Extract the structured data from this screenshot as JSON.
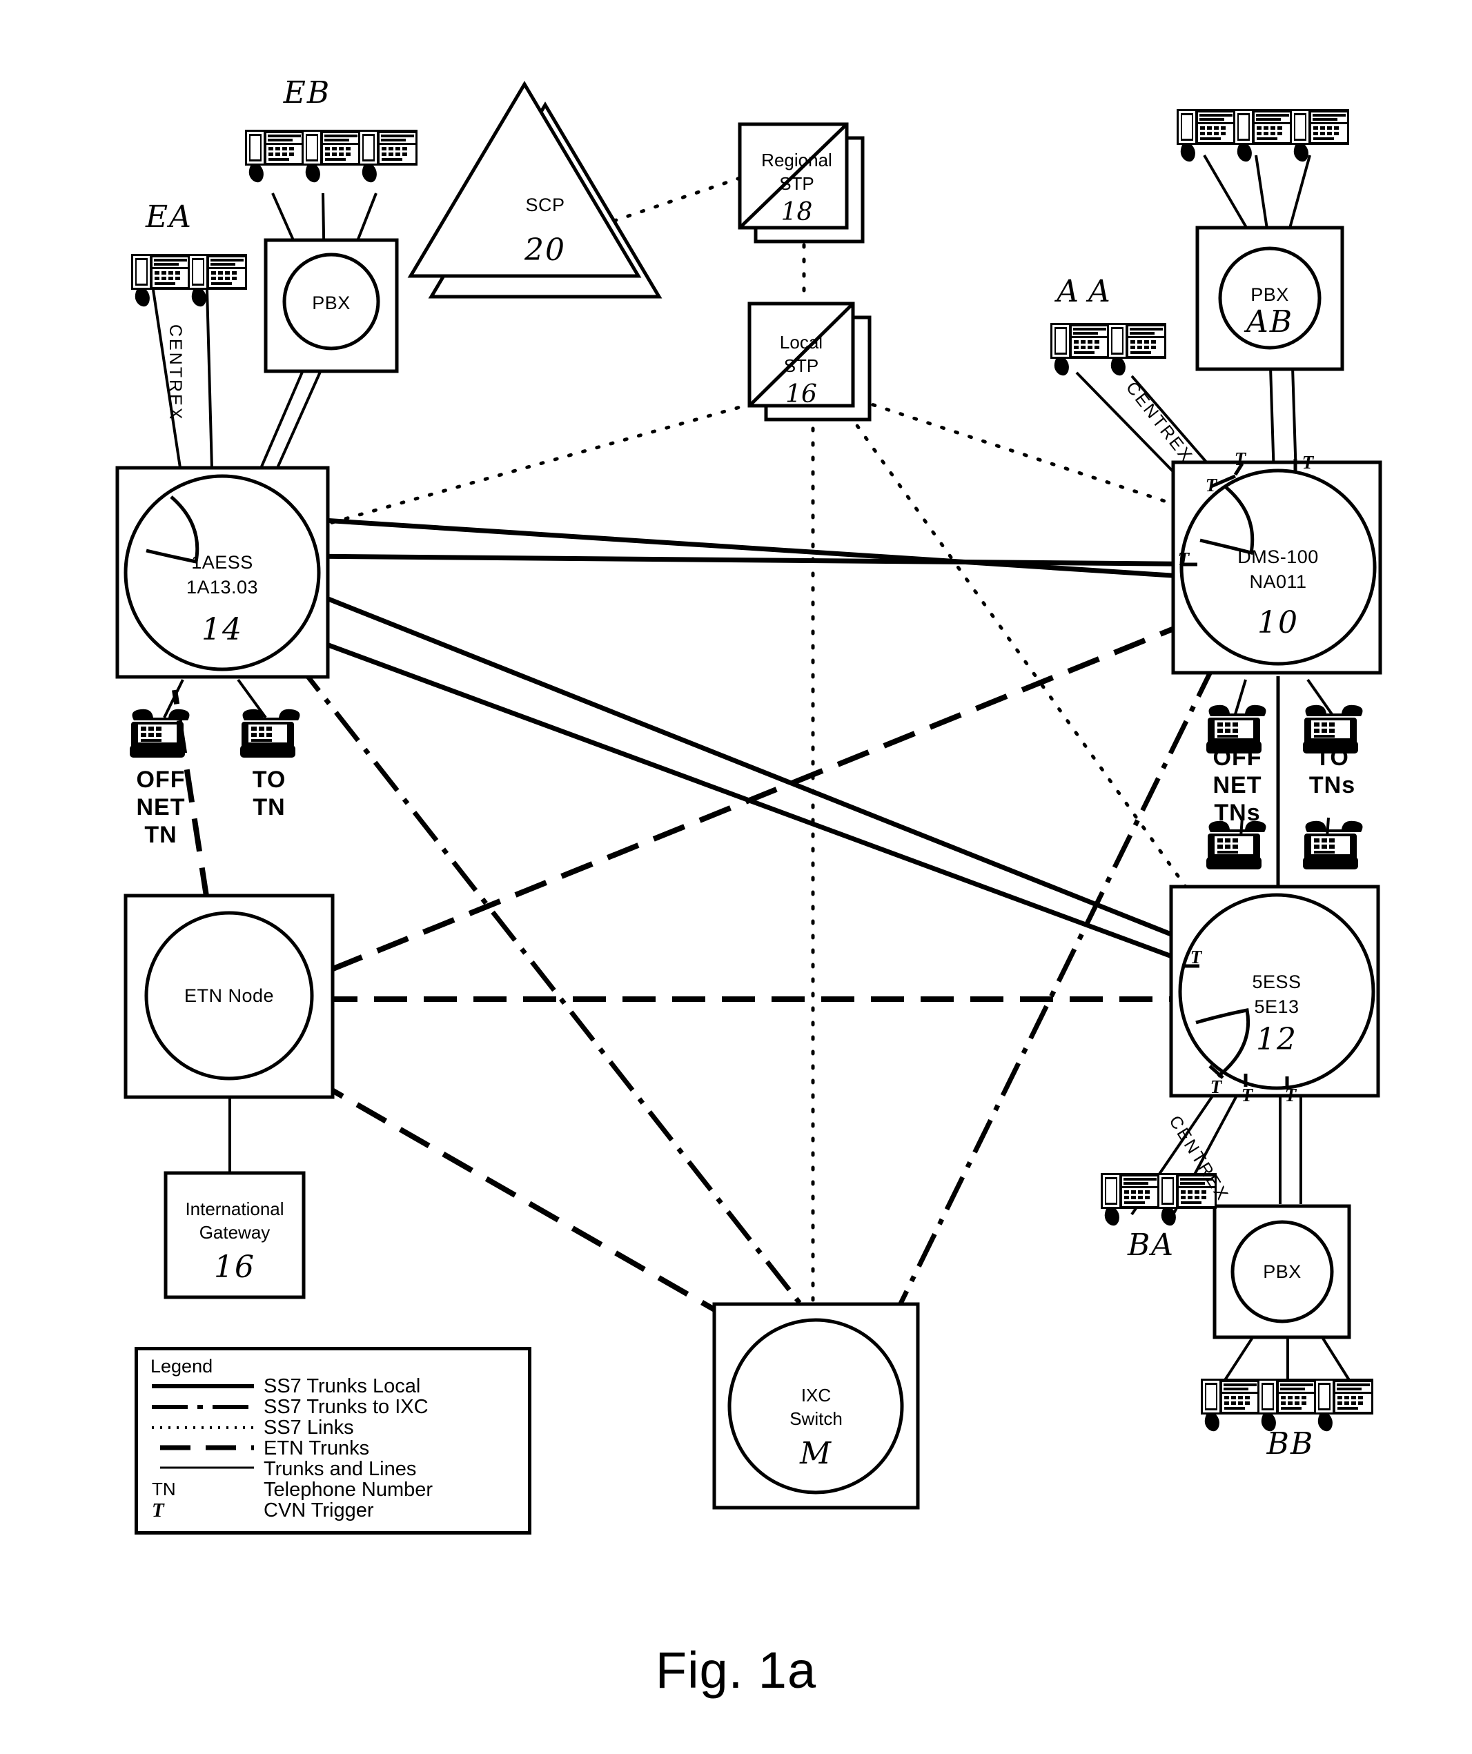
{
  "figure": {
    "caption": "Fig. 1a"
  },
  "nodes": {
    "scp": {
      "label": "SCP",
      "ref": "20",
      "shape": "triangle-stacked"
    },
    "regional_stp": {
      "label_line1": "Regional",
      "label_line2": "STP",
      "ref": "18",
      "shape": "box-stacked-diagonal"
    },
    "local_stp": {
      "label_line1": "Local",
      "label_line2": "STP",
      "ref": "16",
      "shape": "box-stacked-diagonal"
    },
    "ess1a": {
      "label_line1": "1AESS",
      "label_line2": "1A13.03",
      "ref": "14",
      "shape": "circle-in-box"
    },
    "dms100": {
      "label_line1": "DMS-100",
      "label_line2": "NA011",
      "ref": "10",
      "shape": "circle-in-box"
    },
    "ess5": {
      "label_line1": "5ESS",
      "label_line2": "5E13",
      "ref": "12",
      "shape": "circle-in-box"
    },
    "etn_node": {
      "label": "ETN Node",
      "ref": "",
      "shape": "circle-in-box"
    },
    "intl_gateway": {
      "label_line1": "International",
      "label_line2": "Gateway",
      "ref": "16",
      "shape": "box"
    },
    "ixc_switch": {
      "label_line1": "IXC",
      "label_line2": "Switch",
      "ref": "M",
      "shape": "circle-in-box"
    },
    "pbx_left": {
      "label": "PBX",
      "ref": "",
      "shape": "circle-in-box"
    },
    "pbx_top_right": {
      "label": "PBX",
      "ref": "AB",
      "shape": "circle-in-box"
    },
    "pbx_bottom_right": {
      "label": "PBX",
      "ref": "",
      "shape": "circle-in-box"
    }
  },
  "groups": {
    "ea": {
      "ref": "EA",
      "count": 2,
      "note": "centrex-phones-left"
    },
    "eb": {
      "ref": "EB",
      "count": 3,
      "note": "pbx-phones-left"
    },
    "aa": {
      "ref": "AA",
      "count": 2,
      "note": "centrex-phones-top-right"
    },
    "ab": {
      "ref": "AB",
      "count": 3,
      "note": "pbx-phones-top-right"
    },
    "ba": {
      "ref": "BA",
      "count": 2,
      "note": "centrex-phones-bottom-right"
    },
    "bb": {
      "ref": "BB",
      "count": 3,
      "note": "pbx-phones-bottom-right"
    }
  },
  "centrex_labels": {
    "left": "CENTREX",
    "top_right": "CENTREX",
    "bottom_right": "CENTREX"
  },
  "tn_labels": {
    "ess1a_off_net": "OFF\nNET\nTN",
    "ess1a_to_tn": "TO\nTN",
    "dms_off_net": "OFF\nNET\nTNs",
    "dms_to_tns": "TO\nTNs"
  },
  "triggers": {
    "symbol": "T",
    "dms100": [
      "T",
      "T",
      "T",
      "T"
    ],
    "ess5": [
      "T",
      "T",
      "T",
      "T"
    ]
  },
  "legend": {
    "title": "Legend",
    "items": [
      {
        "style": "solid",
        "label": "SS7 Trunks Local"
      },
      {
        "style": "dashdot",
        "label": "SS7 Trunks to IXC"
      },
      {
        "style": "dotted",
        "label": "SS7 Links"
      },
      {
        "style": "dashed",
        "label": "ETN Trunks"
      },
      {
        "style": "thin",
        "label": "Trunks and Lines"
      },
      {
        "style": "text",
        "key": "TN",
        "label": "Telephone Number"
      },
      {
        "style": "text-ital",
        "key": "T",
        "label": "CVN Trigger"
      }
    ]
  },
  "colors": {
    "ink": "#000000",
    "paper": "#ffffff"
  }
}
